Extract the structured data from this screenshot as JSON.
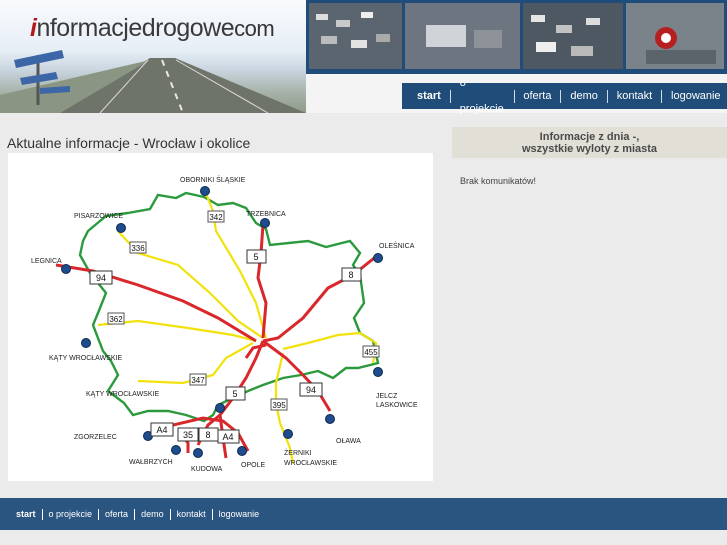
{
  "site": {
    "logo_initial": "i",
    "logo_main": "nformacjedrogowe",
    "logo_suffix": "com"
  },
  "nav": {
    "items": [
      {
        "label": "start",
        "active": true
      },
      {
        "label": "o projekcie"
      },
      {
        "label": "oferta"
      },
      {
        "label": "demo"
      },
      {
        "label": "kontakt"
      },
      {
        "label": "logowanie"
      }
    ]
  },
  "main": {
    "title": "Aktualne informacje - Wrocław i okolice"
  },
  "map": {
    "places": {
      "oborniki": "OBORNIKI ŚLĄSKIE",
      "trzebnica": "TRZEBNICA",
      "pisarzowice": "PISARZOWICE",
      "olesnica": "OLEŚNICA",
      "legnica": "LEGNICA",
      "katy1": "KĄTY WROCŁAWSKIE",
      "katy2": "KĄTY WROCŁAWSKIE",
      "jelcz1": "JELCZ",
      "jelcz2": "LASKOWICE",
      "zgorzelec": "ZGORZELEC",
      "olawa": "OŁAWA",
      "zerniki1": "ŻERNIKI",
      "zerniki2": "WROCŁAWSKIE",
      "walbrzych": "WAŁBRZYCH",
      "kudowa": "KUDOWA",
      "opole": "OPOLE"
    },
    "roads": {
      "r342": "342",
      "r336": "336",
      "r5n": "5",
      "r8": "8",
      "r94w": "94",
      "r362": "362",
      "r455": "455",
      "r347": "347",
      "r5s": "5",
      "r94e": "94",
      "r395": "395",
      "a4w": "A4",
      "r35": "35",
      "r8s": "8",
      "a4e": "A4"
    }
  },
  "info": {
    "heading_line1": "Informacje z dnia -,",
    "heading_line2": "wszystkie wyloty z miasta",
    "message": "Brak komunikatów!"
  },
  "footer": {
    "items": [
      {
        "label": "start",
        "active": true
      },
      {
        "label": "o projekcie"
      },
      {
        "label": "oferta"
      },
      {
        "label": "demo"
      },
      {
        "label": "kontakt"
      },
      {
        "label": "logowanie"
      }
    ]
  }
}
